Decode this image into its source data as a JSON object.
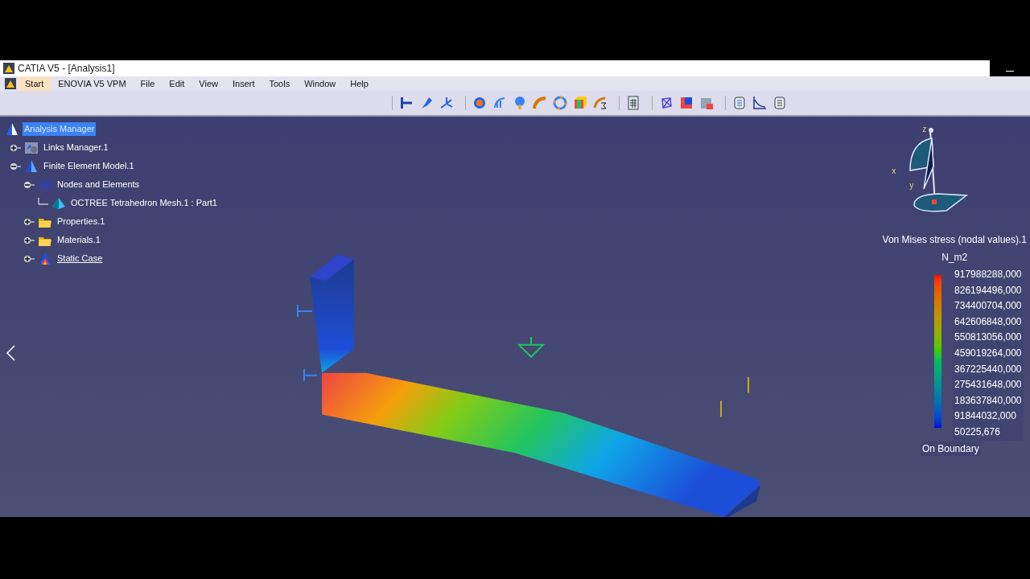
{
  "window": {
    "title": "CATIA V5 - [Analysis1]"
  },
  "menu": [
    {
      "label": "Start",
      "selected": true
    },
    {
      "label": "ENOVIA V5 VPM",
      "selected": false
    },
    {
      "label": "File",
      "selected": false
    },
    {
      "label": "Edit",
      "selected": false
    },
    {
      "label": "View",
      "selected": false
    },
    {
      "label": "Insert",
      "selected": false
    },
    {
      "label": "Tools",
      "selected": false
    },
    {
      "label": "Window",
      "selected": false
    },
    {
      "label": "Help",
      "selected": false
    }
  ],
  "tree": {
    "label": "Analysis Manager",
    "selected": true,
    "children": [
      {
        "label": "Links Manager.1",
        "kind": "links",
        "expanded": false
      },
      {
        "label": "Finite Element Model.1",
        "kind": "model",
        "expanded": true,
        "children": [
          {
            "label": "Nodes and Elements",
            "kind": "nodes",
            "expanded": true,
            "children": [
              {
                "label": "OCTREE Tetrahedron Mesh.1 : Part1",
                "kind": "mesh"
              }
            ]
          },
          {
            "label": "Properties.1",
            "kind": "folder",
            "expanded": false
          },
          {
            "label": "Materials.1",
            "kind": "folder",
            "expanded": false
          },
          {
            "label": "Static Case",
            "kind": "case",
            "expanded": false
          }
        ]
      }
    ]
  },
  "compass": {
    "labels": [
      "z",
      "x",
      "y"
    ]
  },
  "legend": {
    "title": "Von Mises stress (nodal values).1",
    "unit": "N_m2",
    "values": [
      "917988288,000",
      "826194496,000",
      "734400704,000",
      "642606848,000",
      "550813056,000",
      "459019264,000",
      "367225440,000",
      "275431648,000",
      "183637840,000",
      "91844032,000",
      "50225,676"
    ],
    "footer": "On Boundary"
  }
}
